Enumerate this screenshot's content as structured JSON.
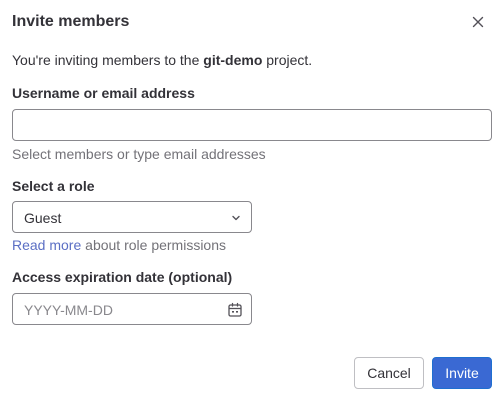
{
  "modal": {
    "title": "Invite members",
    "close_icon": "close-icon"
  },
  "intro": {
    "prefix": "You're inviting members to the ",
    "project": "git-demo",
    "suffix": " project."
  },
  "username_field": {
    "label": "Username or email address",
    "value": "",
    "placeholder": "",
    "help": "Select members or type email addresses"
  },
  "role_field": {
    "label": "Select a role",
    "selected": "Guest",
    "chevron_icon": "chevron-down-icon",
    "help_link": "Read more",
    "help_suffix": " about role permissions"
  },
  "expiration_field": {
    "label": "Access expiration date (optional)",
    "value": "",
    "placeholder": "YYYY-MM-DD",
    "calendar_icon": "calendar-icon"
  },
  "footer": {
    "cancel_label": "Cancel",
    "invite_label": "Invite"
  },
  "colors": {
    "primary": "#3a69d3",
    "link": "#5b6fc4",
    "text": "#333238",
    "muted": "#737278",
    "border": "#89888d"
  }
}
